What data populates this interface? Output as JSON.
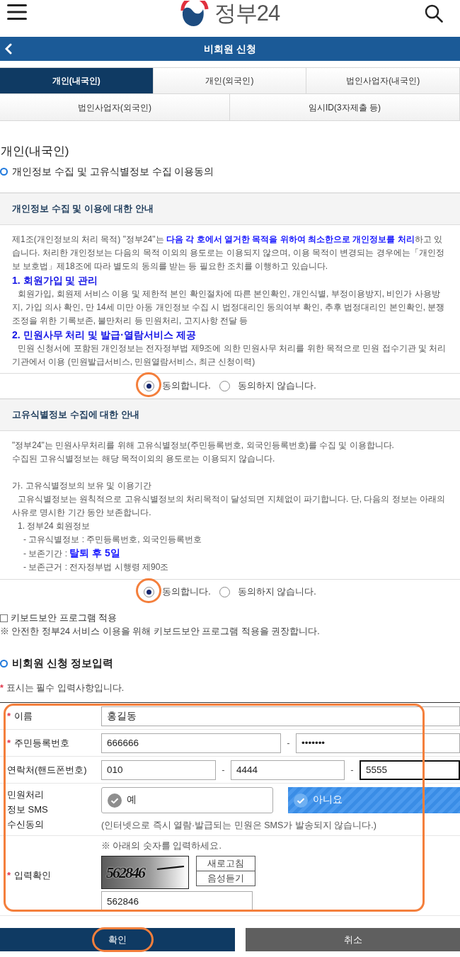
{
  "header": {
    "logo_text": "정부24"
  },
  "title_bar": {
    "title": "비회원 신청"
  },
  "tab_rows": [
    [
      {
        "label": "개인(내국인)",
        "selected": true
      },
      {
        "label": "개인(외국인)",
        "selected": false
      },
      {
        "label": "법인사업자(내국인)",
        "selected": false
      }
    ],
    [
      {
        "label": "법인사업자(외국인)",
        "selected": false
      },
      {
        "label": "임시ID(3자제출 등)",
        "selected": false
      }
    ]
  ],
  "page_heading": "개인(내국인)",
  "consent_heading": "개인정보 수집 및 고유식별정보 수집 이용동의",
  "consents": [
    {
      "title": "개인정보 수집 및 이용에 대한 안내",
      "body": [
        {
          "kind": "paragraph",
          "text": "제1조(개인정보의 처리 목적) \"정부24\"는 **다음 각 호에서 열거한 목적을 위하여 최소한으로 개인정보를 처리**하고 있습니다. 처리한 개인정보는 다음의 목적 이외의 용도로는 이용되지 않으며, 이용 목적이 변경되는 경우에는「개인정보 보호법」제18조에 따라 별도의 동의를 받는 등 필요한 조치를 이행하고 있습니다."
        },
        {
          "kind": "heading",
          "text": "1. 회원가입 및 관리"
        },
        {
          "kind": "indented",
          "text": "회원가입, 회원제 서비스 이용 및 제한적 본인 확인절차에 따른 본인확인, 개인식별, 부정이용방지, 비인가 사용방지, 가입 의사 확인, 만 14세 미만 아동 개인정보 수집 시 법정대리인 동의여부 확인, 추후 법정대리인 본인확인, 분쟁 조정을 위한 기록보존, 불만처리 등 민원처리, 고지사항 전달 등"
        },
        {
          "kind": "heading",
          "text": "2. 민원사무 처리 및 발급·열람서비스 제공"
        },
        {
          "kind": "indented",
          "text": "민원 신청서에 포함된 개인정보는 전자정부법 제9조에 의한 민원사무 처리를 위한 목적으로 민원 접수기관 및 처리기관에서 이용 (민원발급서비스, 민원열람서비스, 최근 신청이력)"
        }
      ],
      "options": [
        {
          "label": "동의합니다.",
          "selected": true,
          "circled": true
        },
        {
          "label": "동의하지 않습니다.",
          "selected": false,
          "circled": false
        }
      ]
    },
    {
      "title": "고유식별정보 수집에 대한 안내",
      "body": [
        {
          "kind": "paragraph",
          "text": "\"정부24\"는 민원사무처리를 위해 고유식별정보(주민등록번호, 외국인등록번호)를 수집 및 이용합니다."
        },
        {
          "kind": "paragraph",
          "text": "수집된 고유식별정보는 해당 목적이외의 용도로는 이용되지 않습니다."
        },
        {
          "kind": "subheading",
          "text": "가. 고유식별정보의 보유 및 이용기간"
        },
        {
          "kind": "indented",
          "text": "고유식별정보는 원칙적으로 고유식별정보의 처리목적이 달성되면 지체없이 파기합니다. 단, 다음의 정보는 아래의 사유로 명시한 기간 동안 보존합니다."
        },
        {
          "kind": "list",
          "text": "1. 정부24 회원정보",
          "children": [
            {
              "text": "- 고유식별정보 : 주민등록번호, 외국인등록번호"
            },
            {
              "text": "- 보존기간 : **탈퇴 후 5일**"
            },
            {
              "text": "- 보존근거 : 전자정부법 시행령 제90조"
            }
          ]
        }
      ],
      "options": [
        {
          "label": "동의합니다.",
          "selected": true,
          "circled": true
        },
        {
          "label": "동의하지 않습니다.",
          "selected": false,
          "circled": false
        }
      ]
    }
  ],
  "keyboard_security": {
    "label": "키보드보안 프로그램 적용",
    "checked": false,
    "note": "※ 안전한 정부24 서비스 이용을 위해 키보드보안 프로그램 적용을 권장합니다."
  },
  "form_heading": "비회원 신청 정보입력",
  "required_note": {
    "mark": "*",
    "text": "표시는 필수 입력사항입니다."
  },
  "form": {
    "circled": true,
    "rows": [
      {
        "kind": "text",
        "mark": "*",
        "label": "이름",
        "values": [
          {
            "value": "홍길동",
            "focused": false
          }
        ]
      },
      {
        "kind": "split",
        "mark": "*",
        "label": "주민등록번호",
        "values": [
          {
            "value": "666666",
            "focused": false
          },
          {
            "prefix": "-",
            "value": "•••••••",
            "focused": false
          }
        ]
      },
      {
        "kind": "split",
        "label": "연락처(핸드폰번호)",
        "values": [
          {
            "value": "010",
            "focused": false
          },
          {
            "prefix": "-",
            "value": "4444",
            "focused": false
          },
          {
            "prefix": "-",
            "value": "5555",
            "focused": true
          }
        ]
      },
      {
        "kind": "choice",
        "label": "민원처리 정보 SMS 수신동의",
        "options": [
          {
            "label": "예",
            "selected": false
          },
          {
            "label": "아니요",
            "selected": true
          }
        ],
        "note": "(인터넷으로 즉시 열람·발급되는 민원은 SMS가 발송되지 않습니다.)"
      },
      {
        "kind": "captcha",
        "mark": "*",
        "label": "입력확인",
        "hint": "※ 아래의 숫자를 입력하세요.",
        "captcha_text": "562846",
        "buttons": [
          "새로고침",
          "음성듣기"
        ],
        "value": "562846"
      }
    ]
  },
  "actions": [
    {
      "label": "확인",
      "kind": "primary",
      "circled": true
    },
    {
      "label": "취소",
      "kind": "secondary",
      "circled": false
    }
  ]
}
